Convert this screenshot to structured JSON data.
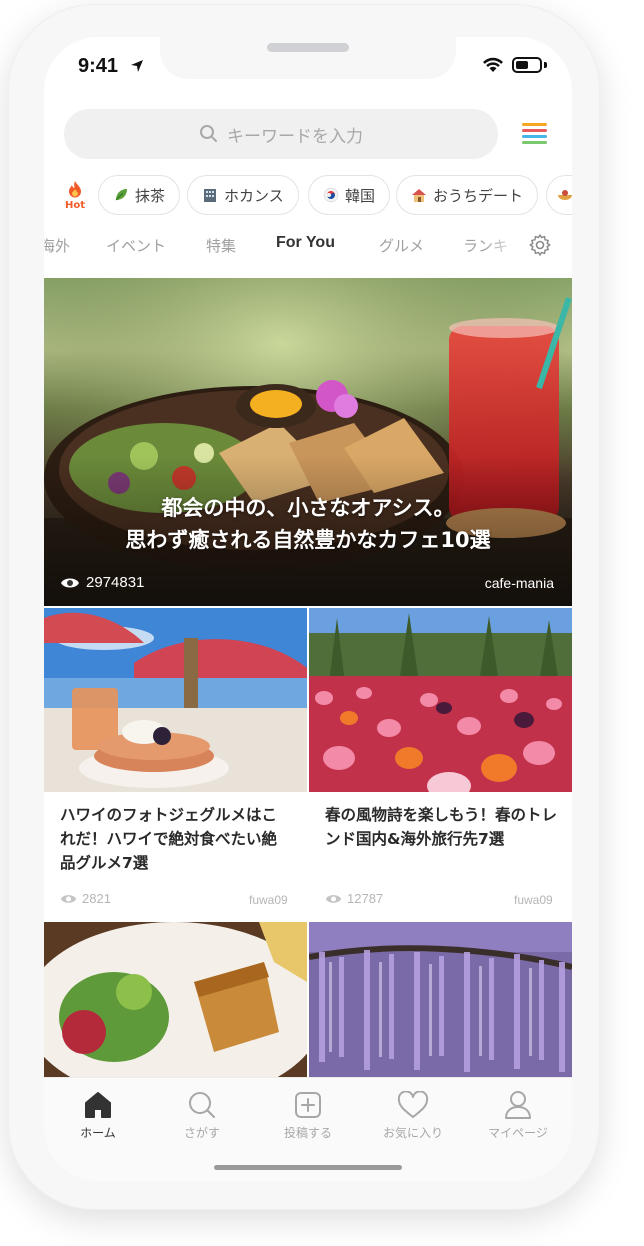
{
  "status": {
    "time": "9:41"
  },
  "search": {
    "placeholder": "キーワードを入力"
  },
  "menu_colors": [
    "#f5a623",
    "#e85a5a",
    "#44b5e5",
    "#7bc96f"
  ],
  "hot_badge": {
    "label": "Hot",
    "color": "#f15a29"
  },
  "chips": [
    {
      "label": "抹茶",
      "icon": "matcha-leaf-icon"
    },
    {
      "label": "ホカンス",
      "icon": "hotel-icon"
    },
    {
      "label": "韓国",
      "icon": "korea-icon"
    },
    {
      "label": "おうちデート",
      "icon": "house-icon"
    }
  ],
  "tabs": [
    {
      "label": "海外"
    },
    {
      "label": "イベント"
    },
    {
      "label": "特集"
    },
    {
      "label": "For You",
      "active": true
    },
    {
      "label": "グルメ"
    },
    {
      "label": "ランキ"
    }
  ],
  "hero": {
    "title_line1": "都会の中の、小さなオアシス。",
    "title_line2": "思わず癒される自然豊かなカフェ10選",
    "views": "2974831",
    "author": "cafe-mania"
  },
  "cards": [
    {
      "title": "ハワイのフォトジェグルメはこれだ！ハワイで絶対食べたい絶品グルメ7選",
      "views": "2821",
      "author": "fuwa09"
    },
    {
      "title": "春の風物詩を楽しもう！春のトレンド国内&海外旅行先7選",
      "views": "12787",
      "author": "fuwa09"
    }
  ],
  "tabbar": [
    {
      "label": "ホーム",
      "icon": "home-icon",
      "active": true
    },
    {
      "label": "さがす",
      "icon": "search-icon"
    },
    {
      "label": "投稿する",
      "icon": "plus-square-icon"
    },
    {
      "label": "お気に入り",
      "icon": "heart-icon"
    },
    {
      "label": "マイページ",
      "icon": "person-icon"
    }
  ]
}
